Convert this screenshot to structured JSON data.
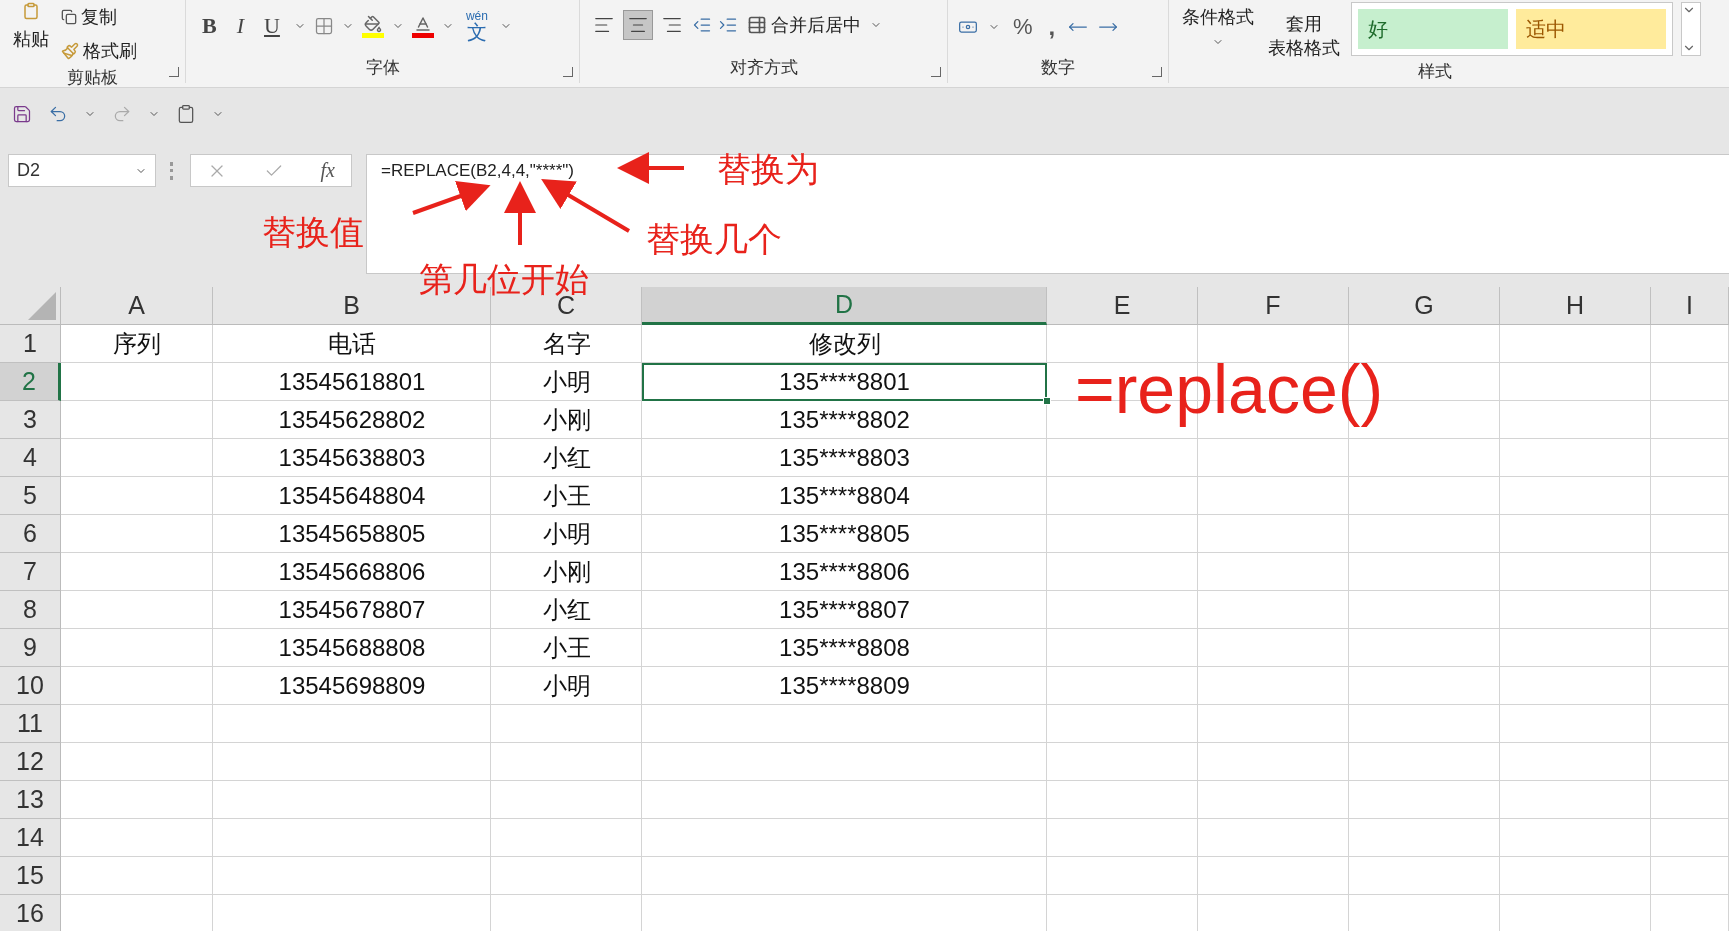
{
  "ribbon": {
    "groups": [
      {
        "kind": "clipboard",
        "label": "剪贴板",
        "paste": "粘贴",
        "copy": "复制",
        "painter": "格式刷"
      },
      {
        "kind": "font",
        "label": "字体",
        "bold": "B",
        "italic": "I",
        "underline": "U",
        "phonetic_top": "wén",
        "phonetic_bottom": "文"
      },
      {
        "kind": "alignment",
        "label": "对齐方式",
        "align": [
          {
            "selected": false
          },
          {
            "selected": true
          },
          {
            "selected": false
          }
        ],
        "merge": "合并后居中"
      },
      {
        "kind": "number",
        "label": "数字",
        "percent": "%",
        "comma": ","
      },
      {
        "kind": "styles",
        "label": "样式",
        "conditional": "条件格式",
        "table_top": "套用",
        "table_bottom": "表格格式",
        "styles": [
          {
            "text": "好",
            "color": "#c6efce"
          },
          {
            "text": "适中",
            "color": "#ffeb9c"
          }
        ]
      }
    ]
  },
  "formula_bar": {
    "name_box": "D2",
    "fx": "fx",
    "formula": "=REPLACE(B2,4,4,\"****\")"
  },
  "columns": [
    {
      "label": "A",
      "selected": false
    },
    {
      "label": "B",
      "selected": false
    },
    {
      "label": "C",
      "selected": false
    },
    {
      "label": "D",
      "selected": true
    },
    {
      "label": "E",
      "selected": false
    },
    {
      "label": "F",
      "selected": false
    },
    {
      "label": "G",
      "selected": false
    },
    {
      "label": "H",
      "selected": false
    },
    {
      "label": "I",
      "selected": false
    }
  ],
  "rows": [
    {
      "number": "1",
      "selected": false,
      "cells": {
        "A": "序列",
        "B": "电话",
        "C": "名字",
        "D": "修改列"
      }
    },
    {
      "number": "2",
      "selected": true,
      "cells": {
        "B": "13545618801",
        "C": "小明",
        "D": "135****8801"
      }
    },
    {
      "number": "3",
      "selected": false,
      "cells": {
        "B": "13545628802",
        "C": "小刚",
        "D": "135****8802"
      }
    },
    {
      "number": "4",
      "selected": false,
      "cells": {
        "B": "13545638803",
        "C": "小红",
        "D": "135****8803"
      }
    },
    {
      "number": "5",
      "selected": false,
      "cells": {
        "B": "13545648804",
        "C": "小王",
        "D": "135****8804"
      }
    },
    {
      "number": "6",
      "selected": false,
      "cells": {
        "B": "13545658805",
        "C": "小明",
        "D": "135****8805"
      }
    },
    {
      "number": "7",
      "selected": false,
      "cells": {
        "B": "13545668806",
        "C": "小刚",
        "D": "135****8806"
      }
    },
    {
      "number": "8",
      "selected": false,
      "cells": {
        "B": "13545678807",
        "C": "小红",
        "D": "135****8807"
      }
    },
    {
      "number": "9",
      "selected": false,
      "cells": {
        "B": "13545688808",
        "C": "小王",
        "D": "135****8808"
      }
    },
    {
      "number": "10",
      "selected": false,
      "cells": {
        "B": "13545698809",
        "C": "小明",
        "D": "135****8809"
      }
    },
    {
      "number": "11",
      "selected": false
    },
    {
      "number": "12",
      "selected": false
    },
    {
      "number": "13",
      "selected": false
    },
    {
      "number": "14",
      "selected": false
    },
    {
      "number": "15",
      "selected": false
    },
    {
      "number": "16",
      "selected": false
    }
  ],
  "annotations": [
    {
      "kind": "label",
      "text": "替换为"
    },
    {
      "kind": "label",
      "text": "替换值"
    },
    {
      "kind": "label",
      "text": "替换几个"
    },
    {
      "kind": "label",
      "text": "第几位开始"
    },
    {
      "kind": "title",
      "text": "=replace()"
    }
  ]
}
